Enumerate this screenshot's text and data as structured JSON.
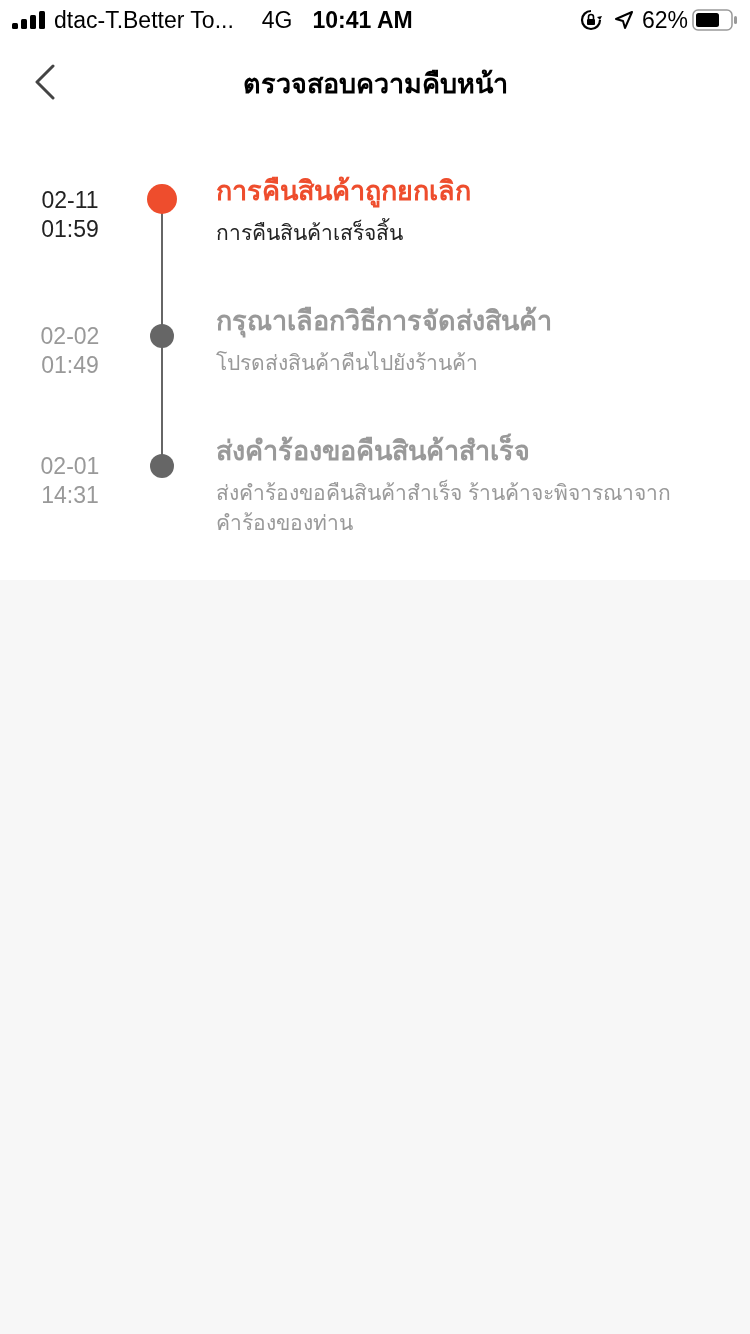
{
  "status_bar": {
    "carrier": "dtac-T.Better To...",
    "network": "4G",
    "time": "10:41 AM",
    "battery": "62%"
  },
  "nav": {
    "title": "ตรวจสอบความคืบหน้า"
  },
  "timeline": [
    {
      "date": "02-11",
      "time": "01:59",
      "title": "การคืนสินค้าถูกยกเลิก",
      "description": "การคืนสินค้าเสร็จสิ้น",
      "active": true
    },
    {
      "date": "02-02",
      "time": "01:49",
      "title": "กรุณาเลือกวิธีการจัดส่งสินค้า",
      "description": "โปรดส่งสินค้าคืนไปยังร้านค้า",
      "active": false
    },
    {
      "date": "02-01",
      "time": "14:31",
      "title": "ส่งคำร้องขอคืนสินค้าสำเร็จ",
      "description": "ส่งคำร้องขอคืนสินค้าสำเร็จ ร้านค้าจะพิจารณาจากคำร้องของท่าน",
      "active": false
    }
  ]
}
